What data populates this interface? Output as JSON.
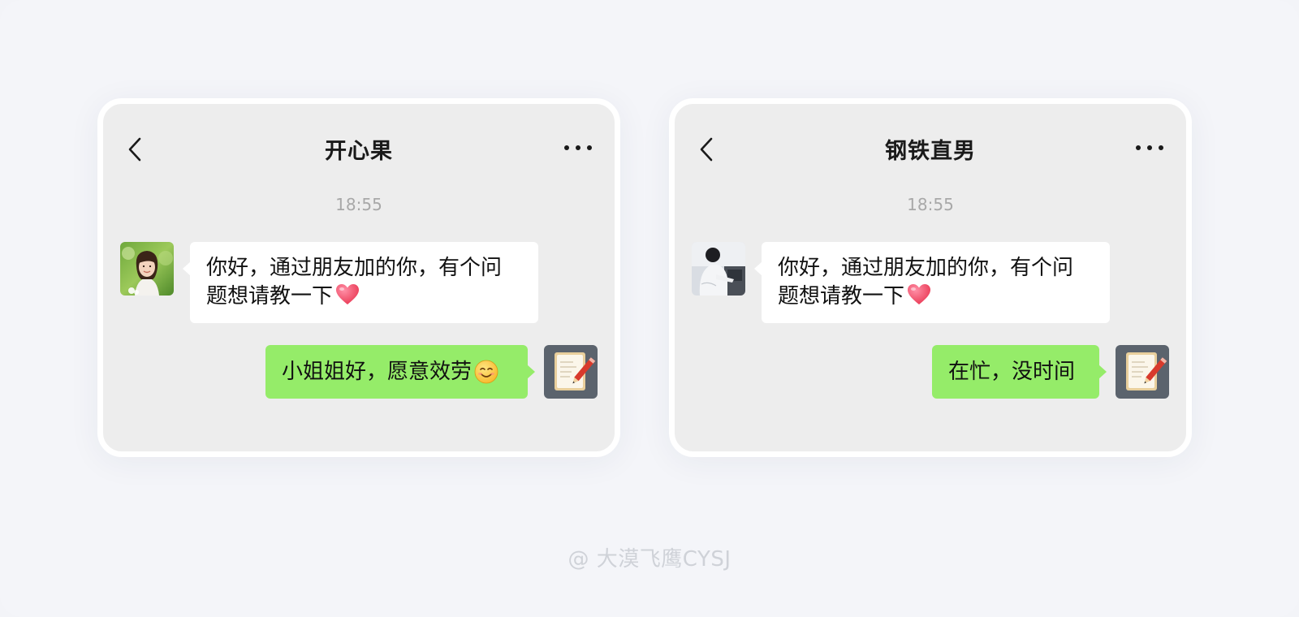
{
  "chats": [
    {
      "title": "开心果",
      "timestamp": "18:55",
      "incoming": {
        "line1": "你好，通过朋友加的你，有个问",
        "line2": "题想请教一下",
        "emoji": "heart-icon"
      },
      "outgoing": {
        "text": "小姐姐好，愿意效劳",
        "emoji": "smiling-face-icon"
      },
      "contact_avatar": "woman-photo-avatar",
      "self_avatar": "notepad-pencil-avatar"
    },
    {
      "title": "钢铁直男",
      "timestamp": "18:55",
      "incoming": {
        "line1": "你好，通过朋友加的你，有个问",
        "line2": "题想请教一下",
        "emoji": "heart-icon"
      },
      "outgoing": {
        "text": "在忙，没时间"
      },
      "contact_avatar": "man-photo-avatar",
      "self_avatar": "notepad-pencil-avatar"
    }
  ],
  "watermark": "@ 大漠飞鹰CYSJ",
  "colors": {
    "chat_background": "#ededed",
    "incoming_bubble": "#ffffff",
    "outgoing_bubble": "#95ec69",
    "timestamp_text": "#a8a8a8",
    "page_background": "#f4f5f9"
  }
}
